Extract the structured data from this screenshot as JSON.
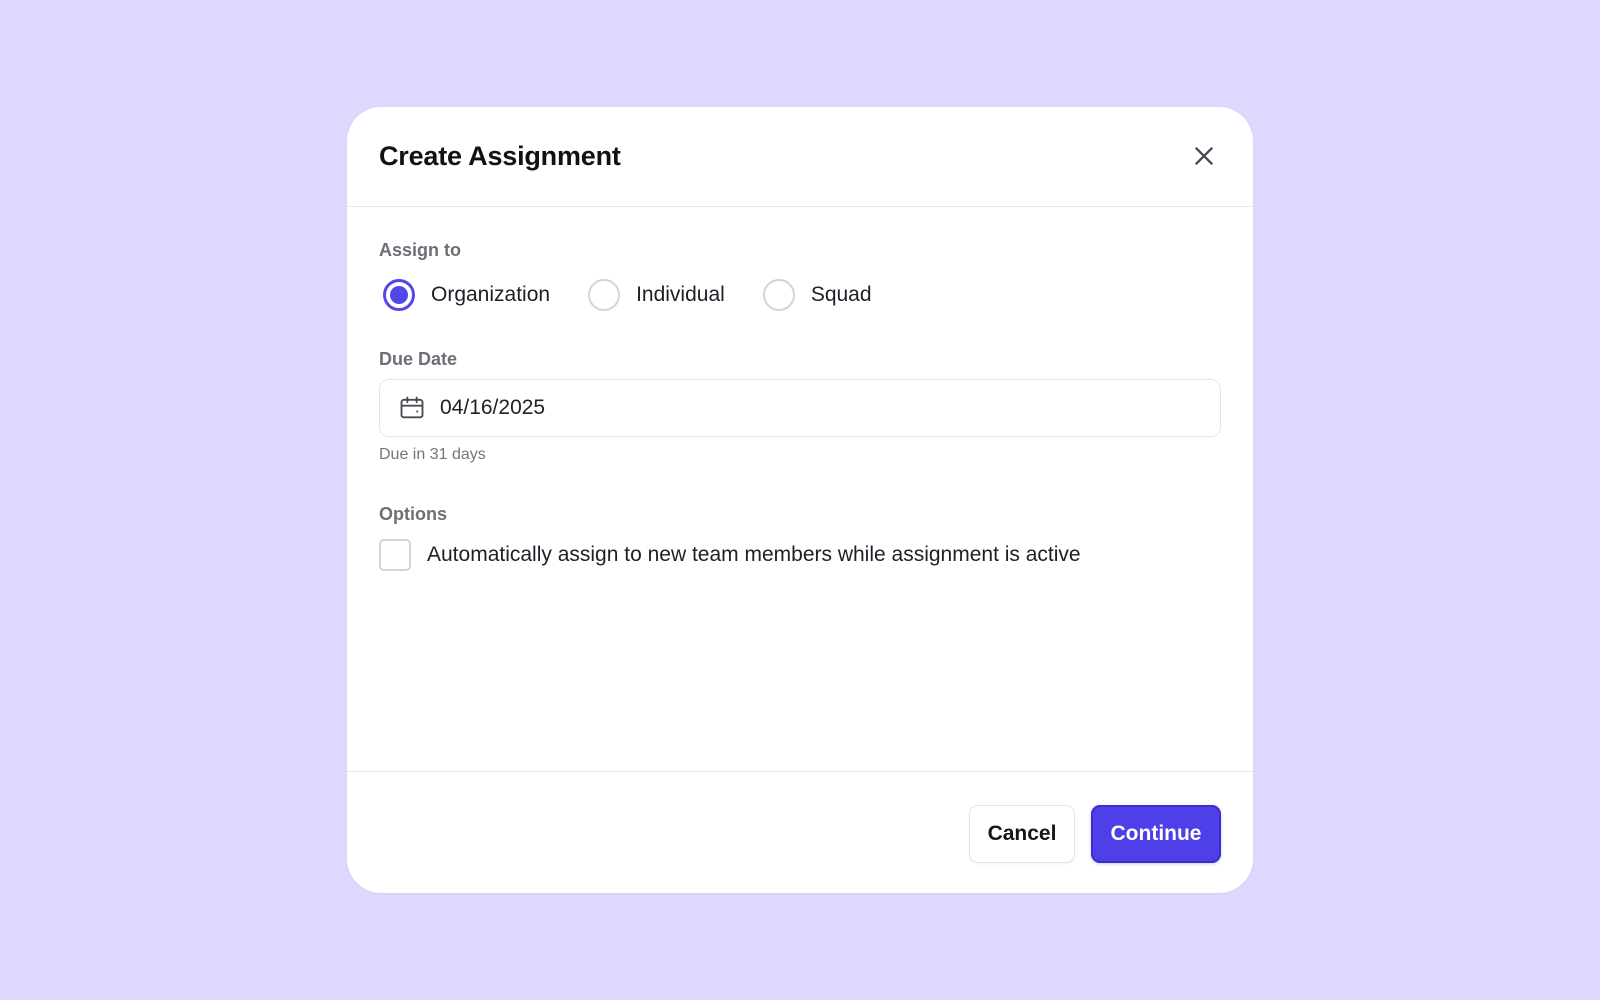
{
  "dialog": {
    "title": "Create Assignment",
    "close_icon": "close-icon"
  },
  "assign_to": {
    "label": "Assign to",
    "options": [
      {
        "label": "Organization",
        "checked": true
      },
      {
        "label": "Individual",
        "checked": false
      },
      {
        "label": "Squad",
        "checked": false
      }
    ]
  },
  "due_date": {
    "label": "Due Date",
    "icon": "calendar-icon",
    "value": "04/16/2025",
    "helper": "Due in 31 days"
  },
  "options": {
    "label": "Options",
    "auto_assign": {
      "label": "Automatically assign to new team members while assignment is active",
      "checked": false
    }
  },
  "footer": {
    "cancel_label": "Cancel",
    "continue_label": "Continue"
  },
  "colors": {
    "background": "#ddd8fd",
    "accent": "#4f3fe8",
    "surface": "#ffffff"
  }
}
